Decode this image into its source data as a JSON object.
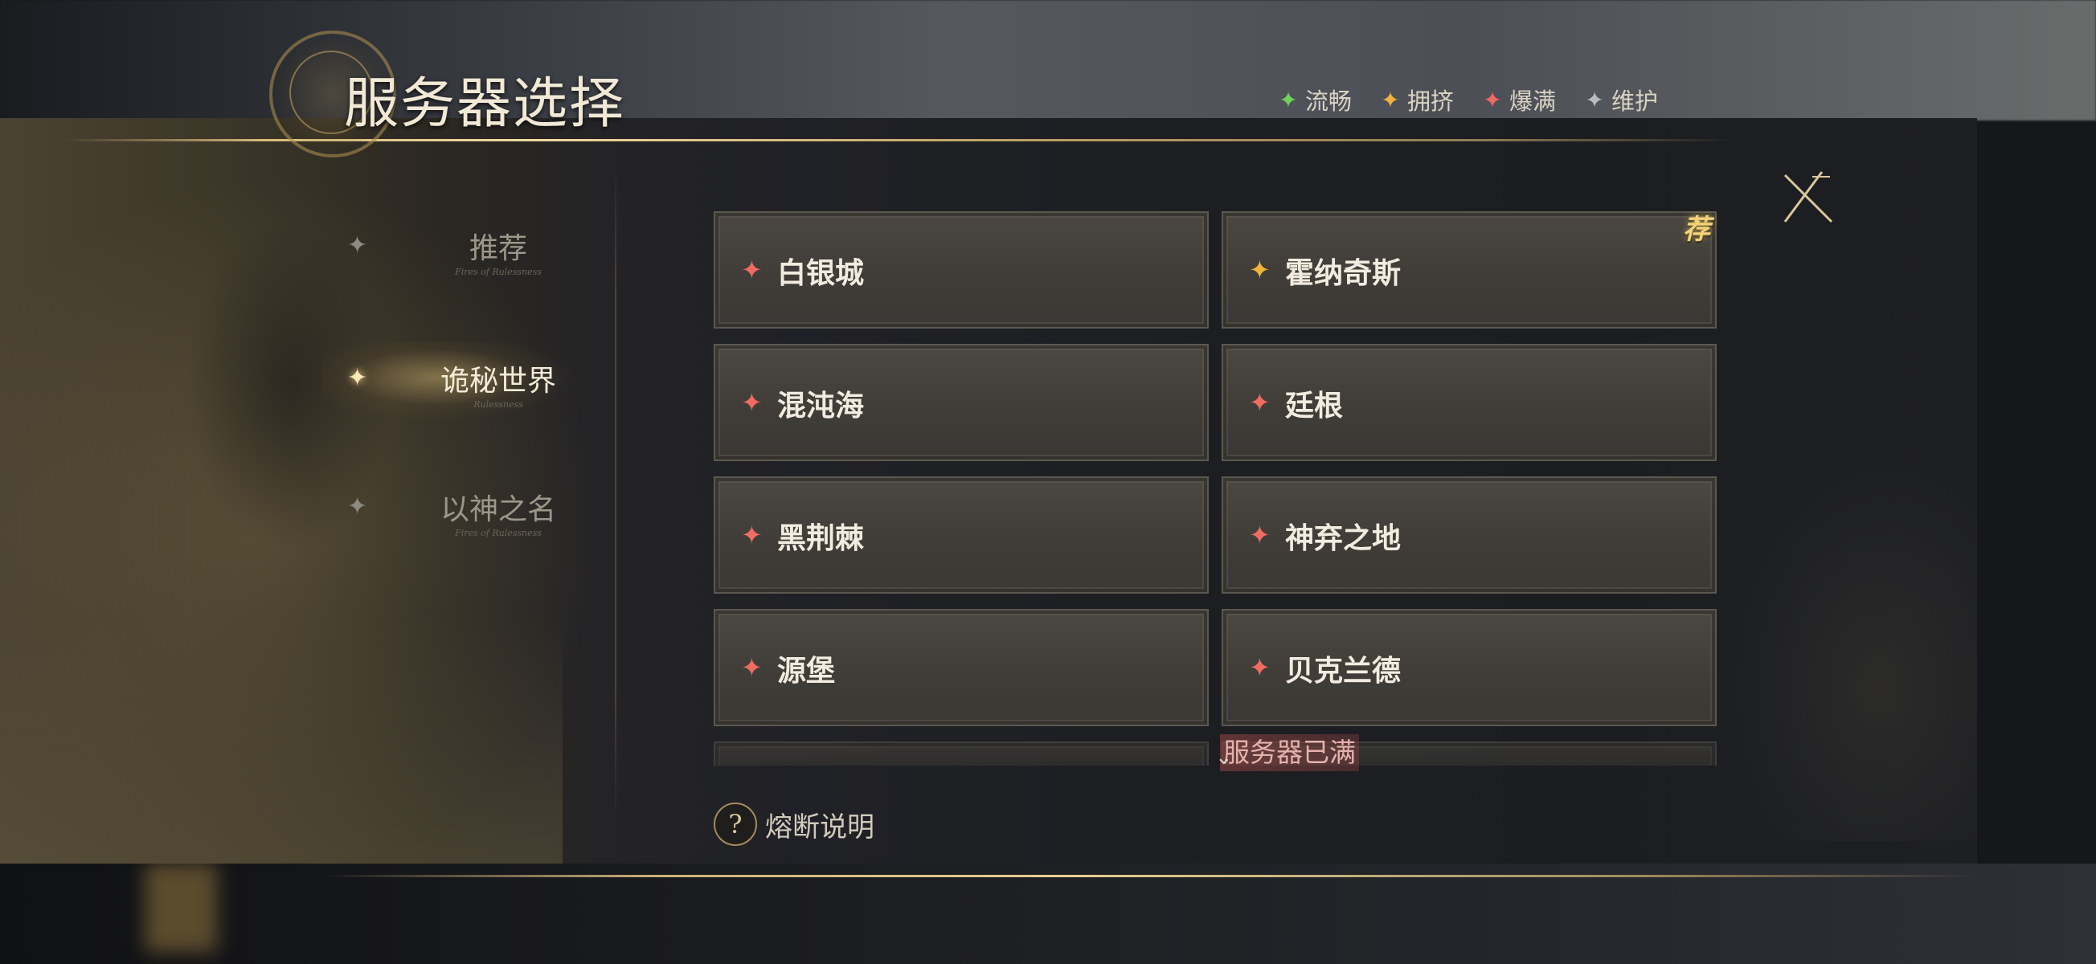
{
  "title": "服务器选择",
  "legend": [
    {
      "label": "流畅",
      "color": "#6fd35a",
      "icon": "star-green-icon"
    },
    {
      "label": "拥挤",
      "color": "#f0b43c",
      "icon": "star-yellow-icon"
    },
    {
      "label": "爆满",
      "color": "#f06b62",
      "icon": "star-red-icon"
    },
    {
      "label": "维护",
      "color": "#b8bcc4",
      "icon": "star-gray-icon"
    }
  ],
  "nav": {
    "items": [
      {
        "label": "推荐",
        "sub": "Fires of Rulessness",
        "active": false
      },
      {
        "label": "诡秘世界",
        "sub": "Rulessness",
        "active": true
      },
      {
        "label": "以神之名",
        "sub": "Fires of Rulessness",
        "active": false
      }
    ]
  },
  "servers": [
    {
      "name": "白银城",
      "status": "爆满",
      "color": "#f06b62"
    },
    {
      "name": "霍纳奇斯",
      "status": "拥挤",
      "color": "#f0b43c",
      "badge": "荐"
    },
    {
      "name": "混沌海",
      "status": "爆满",
      "color": "#f06b62"
    },
    {
      "name": "廷根",
      "status": "爆满",
      "color": "#f06b62"
    },
    {
      "name": "黑荆棘",
      "status": "爆满",
      "color": "#f06b62"
    },
    {
      "name": "神弃之地",
      "status": "爆满",
      "color": "#f06b62"
    },
    {
      "name": "源堡",
      "status": "爆满",
      "color": "#f06b62"
    },
    {
      "name": "贝克兰德",
      "status": "爆满",
      "color": "#f06b62"
    }
  ],
  "toast": "服务器已满",
  "fuse_help": "熔断说明",
  "icons": {
    "close": "close-icon",
    "help": "question-icon",
    "scroll": "chevron-down-icon"
  }
}
